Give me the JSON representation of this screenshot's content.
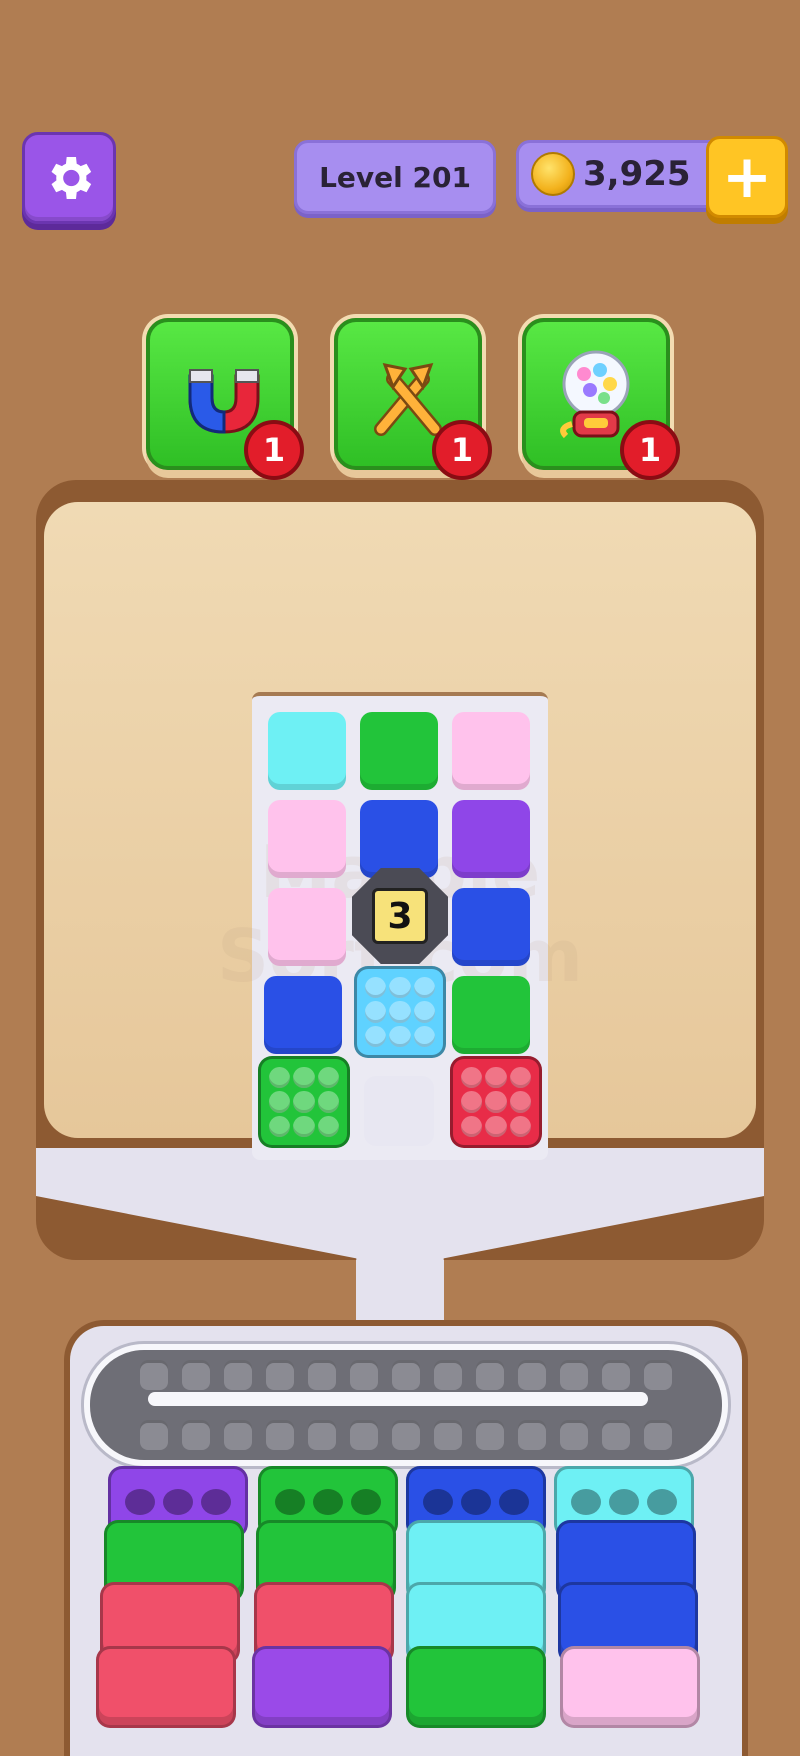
{
  "hud": {
    "level_label": "Level 201",
    "coins": "3,925",
    "plus_symbol": "+"
  },
  "boosters": [
    {
      "name": "magnet",
      "icon": "magnet-icon",
      "count": "1"
    },
    {
      "name": "swap",
      "icon": "swap-arrows-icon",
      "count": "1"
    },
    {
      "name": "gumball",
      "icon": "gumball-machine-icon",
      "count": "1"
    }
  ],
  "board": {
    "lock_count": "3",
    "watermark": "Marble Sort.com"
  },
  "colors": {
    "cyan": "#6ef0f4",
    "green": "#22c43a",
    "pink": "#ffc2ec",
    "blue": "#2a50e6",
    "purple": "#8f46e8",
    "red": "#e82c48",
    "empty": "#e8e7f2"
  }
}
